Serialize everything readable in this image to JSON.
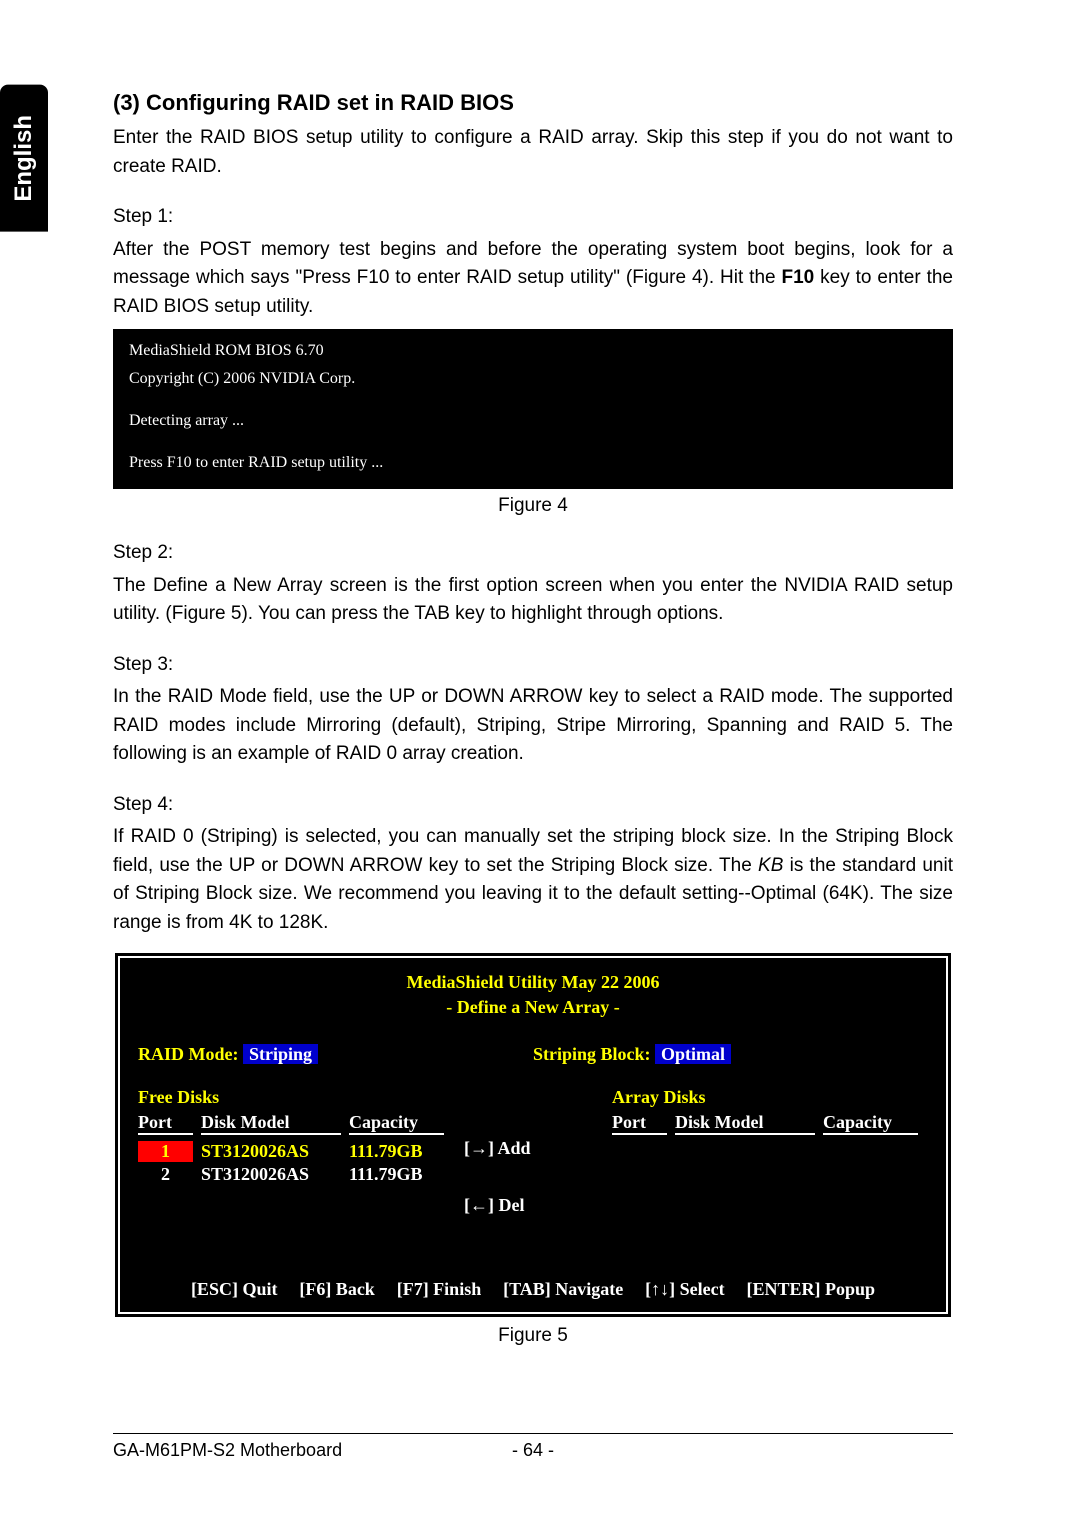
{
  "language_tab": "English",
  "section": {
    "heading": "(3) Configuring RAID set in RAID BIOS",
    "intro": "Enter the RAID BIOS setup utility to configure a RAID array. Skip this step if you do not want to create RAID."
  },
  "step1": {
    "label": "Step 1:",
    "text_before": "After the POST memory test begins and before the operating system boot begins, look for a message which says \"Press F10 to enter RAID setup utility\" (Figure 4). Hit the ",
    "f10": "F10",
    "text_after": " key to enter the RAID BIOS setup utility."
  },
  "console": {
    "line1": "MediaShield ROM BIOS 6.70",
    "line2": "Copyright (C) 2006 NVIDIA Corp.",
    "line3": "Detecting array ...",
    "line4": "Press F10 to enter RAID setup utility ..."
  },
  "figure4_caption": "Figure 4",
  "step2": {
    "label": "Step 2:",
    "text": "The Define a New Array screen is the first option screen when you enter the NVIDIA RAID setup utility. (Figure 5). You can press the TAB key to highlight through options."
  },
  "step3": {
    "label": "Step 3:",
    "text": "In the RAID Mode field, use the UP or DOWN ARROW key to select a RAID mode. The supported RAID modes include Mirroring (default), Striping, Stripe Mirroring, Spanning and RAID 5. The following is an example of RAID 0 array creation."
  },
  "step4": {
    "label": "Step 4:",
    "text_before": "If RAID 0 (Striping) is selected, you can manually set the striping block size. In the Striping Block field, use the UP or DOWN ARROW key to set the Striping Block size. The ",
    "kb": "KB",
    "text_after": " is the standard unit of Striping Block size.  We recommend you leaving it to the default setting--Optimal (64K). The size range is from 4K to 128K."
  },
  "bios": {
    "title_line1": "MediaShield Utility  May 22 2006",
    "title_line2": "- Define a New Array -",
    "raid_mode_label": "RAID Mode: ",
    "raid_mode_value": "Striping",
    "striping_block_label": "Striping Block: ",
    "striping_block_value": "Optimal",
    "free_disks_label": "Free Disks",
    "array_disks_label": "Array Disks",
    "col_port": "Port",
    "col_model": "Disk Model",
    "col_capacity": "Capacity",
    "free_disks": [
      {
        "port": "1",
        "model": "ST3120026AS",
        "capacity": "111.79GB",
        "selected": true
      },
      {
        "port": "2",
        "model": "ST3120026AS",
        "capacity": "111.79GB",
        "selected": false
      }
    ],
    "add_label": "[→] Add",
    "del_label": "[←] Del",
    "footer": {
      "quit": "[ESC] Quit",
      "back": "[F6] Back",
      "finish": "[F7] Finish",
      "navigate": "[TAB] Navigate",
      "select": "[↑↓] Select",
      "popup": "[ENTER] Popup"
    }
  },
  "figure5_caption": "Figure 5",
  "footer": {
    "product": "GA-M61PM-S2 Motherboard",
    "page": "- 64 -"
  }
}
